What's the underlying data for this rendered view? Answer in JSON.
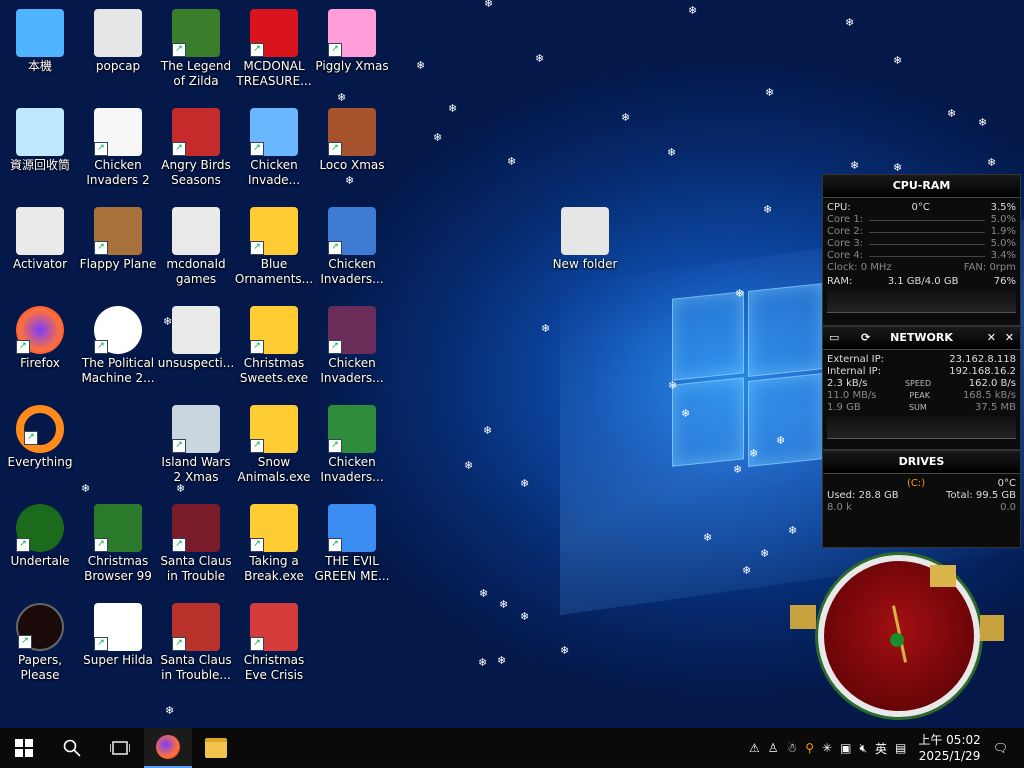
{
  "desktop": {
    "icons": [
      {
        "label": "本機",
        "glyph": "pc"
      },
      {
        "label": "popcap",
        "glyph": "folder"
      },
      {
        "label": "The Legend of Zilda",
        "glyph": "game"
      },
      {
        "label": "MCDONAL TREASURE...",
        "glyph": "mcd"
      },
      {
        "label": "Piggly Xmas",
        "glyph": "pig"
      },
      {
        "label": "資源回收筒",
        "glyph": "bin"
      },
      {
        "label": "Chicken Invaders 2",
        "glyph": "chicken"
      },
      {
        "label": "Angry Birds Seasons",
        "glyph": "angry"
      },
      {
        "label": "Chicken Invade...",
        "glyph": "snow"
      },
      {
        "label": "Loco Xmas",
        "glyph": "bear"
      },
      {
        "label": "Activator",
        "glyph": "file"
      },
      {
        "label": "Flappy Plane",
        "glyph": "flappy"
      },
      {
        "label": "mcdonald games",
        "glyph": "file"
      },
      {
        "label": "Blue Ornaments...",
        "glyph": "star"
      },
      {
        "label": "Chicken Invaders...",
        "glyph": "chicken3"
      },
      {
        "label": "Firefox",
        "glyph": "firefox"
      },
      {
        "label": "The Political Machine 2...",
        "glyph": "political"
      },
      {
        "label": "unsuspecti...",
        "glyph": "file"
      },
      {
        "label": "Christmas Sweets.exe",
        "glyph": "star"
      },
      {
        "label": "Chicken Invaders...",
        "glyph": "chicken4"
      },
      {
        "label": "Everything",
        "glyph": "search"
      },
      {
        "label": "Island Wars 2 Xmas",
        "glyph": "island"
      },
      {
        "label": "Snow Animals.exe",
        "glyph": "star"
      },
      {
        "label": "Chicken Invaders...",
        "glyph": "chicken5"
      },
      {
        "label": "Undertale",
        "glyph": "undertale"
      },
      {
        "label": "Christmas Browser 99",
        "glyph": "tree"
      },
      {
        "label": "Santa Claus in Trouble",
        "glyph": "santa"
      },
      {
        "label": "Taking a Break.exe",
        "glyph": "star"
      },
      {
        "label": "THE EVIL GREEN ME...",
        "glyph": "msn"
      },
      {
        "label": "Papers, Please",
        "glyph": "papers"
      },
      {
        "label": "Super Hilda",
        "glyph": "hilda"
      },
      {
        "label": "Santa Claus in Trouble...",
        "glyph": "santa2"
      },
      {
        "label": "Christmas Eve Crisis",
        "glyph": "santa3"
      },
      {
        "label": "New folder",
        "glyph": "folder-new"
      }
    ]
  },
  "cpu_ram": {
    "title": "CPU-RAM",
    "cpu_label": "CPU:",
    "cpu_temp": "0°C",
    "cpu_usage": "3.5%",
    "cores": [
      {
        "label": "Core 1:",
        "value": "5.0%"
      },
      {
        "label": "Core 2:",
        "value": "1.9%"
      },
      {
        "label": "Core 3:",
        "value": "5.0%"
      },
      {
        "label": "Core 4:",
        "value": "3.4%"
      }
    ],
    "clock": "Clock: 0 MHz",
    "fan": "FAN: 0rpm",
    "ram_label": "RAM:",
    "ram_value": "3.1 GB/4.0 GB",
    "ram_pct": "76%"
  },
  "network": {
    "title": "NETWORK",
    "external_label": "External IP:",
    "external_ip": "23.162.8.118",
    "internal_label": "Internal IP:",
    "internal_ip": "192.168.16.2",
    "speed_left": "2.3 kB/s",
    "speed_label": "SPEED",
    "speed_right": "162.0 B/s",
    "peak_left": "11.0 MB/s",
    "peak_label": "PEAK",
    "peak_right": "168.5 kB/s",
    "sum_left": "1.9 GB",
    "sum_label": "SUM",
    "sum_right": "37.5 MB"
  },
  "drives": {
    "title": "DRIVES",
    "drive_letter": "(C:)",
    "temp": "0°C",
    "used": "Used: 28.8 GB",
    "total": "Total: 99.5 GB",
    "read": "8.0 k",
    "write": "0.0"
  },
  "taskbar": {
    "clock_time": "上午 05:02",
    "clock_date": "2025/1/29",
    "ime": "英"
  }
}
